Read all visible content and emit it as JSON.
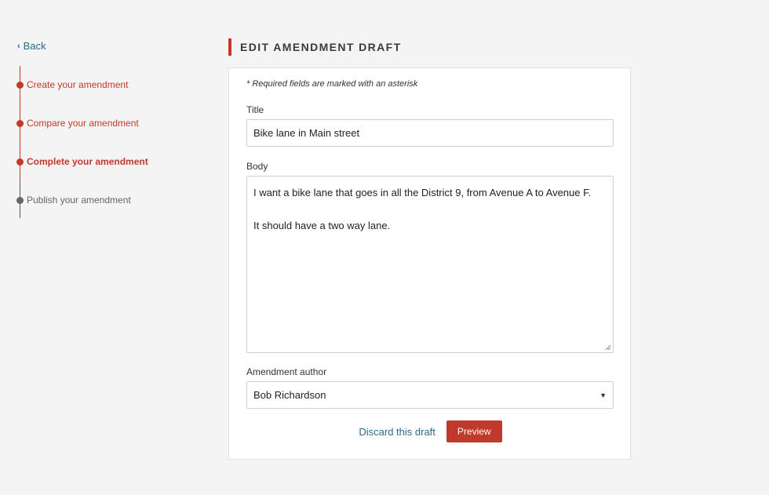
{
  "nav": {
    "back_label": "Back"
  },
  "steps": [
    {
      "label": "Create your amendment",
      "state": "done"
    },
    {
      "label": "Compare your amendment",
      "state": "done"
    },
    {
      "label": "Complete your amendment",
      "state": "current"
    },
    {
      "label": "Publish your amendment",
      "state": "upcoming"
    }
  ],
  "page": {
    "title": "EDIT AMENDMENT DRAFT"
  },
  "form": {
    "required_note": "* Required fields are marked with an asterisk",
    "title_label": "Title",
    "title_value": "Bike lane in Main street",
    "body_label": "Body",
    "body_line1": "I want a bike lane that goes in all the District 9, from Avenue A to Avenue F.",
    "body_line2": "It should have a two way lane.",
    "author_label": "Amendment author",
    "author_value": "Bob Richardson",
    "discard_label": "Discard this draft",
    "preview_label": "Preview"
  },
  "colors": {
    "accent": "#c0392b",
    "link": "#2c6b8a",
    "background": "#f4f4f4"
  },
  "icons": {
    "back": "chevron-left-icon",
    "select": "caret-down-icon"
  }
}
